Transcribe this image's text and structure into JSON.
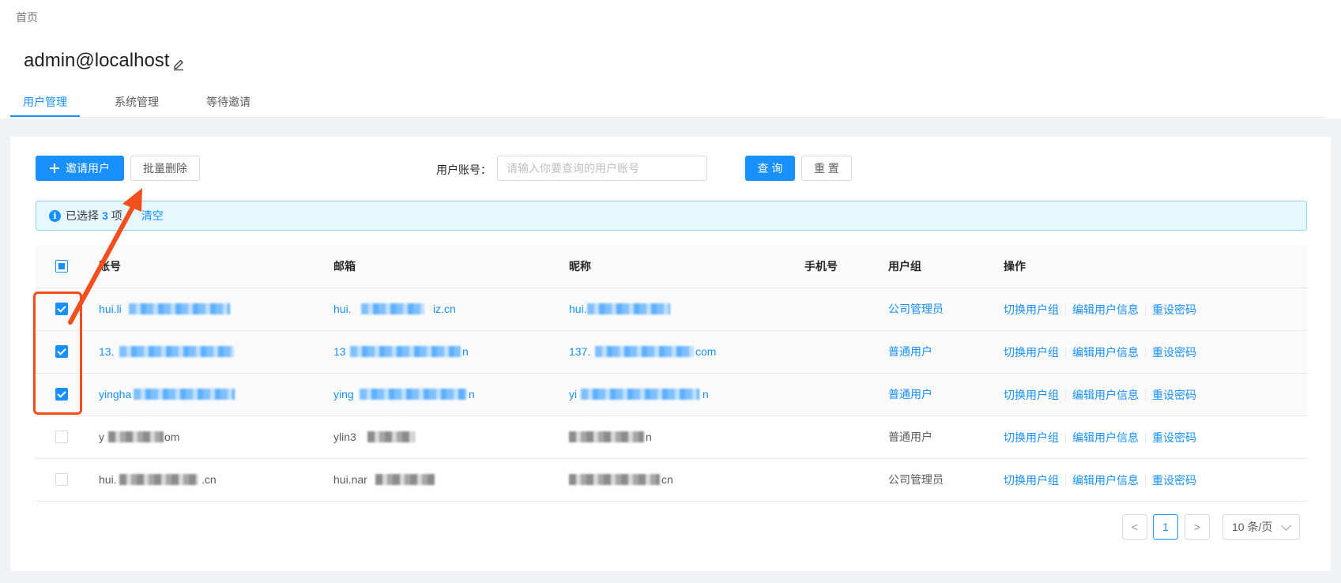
{
  "breadcrumb": "首页",
  "page_title": "admin@localhost",
  "tabs": [
    {
      "label": "用户管理",
      "active": true
    },
    {
      "label": "系统管理",
      "active": false
    },
    {
      "label": "等待邀请",
      "active": false
    }
  ],
  "toolbar": {
    "invite_label": "邀请用户",
    "batch_delete_label": "批量删除",
    "account_label": "用户账号：",
    "account_placeholder": "请输入你要查询的用户账号",
    "query_label": "查 询",
    "reset_label": "重 置"
  },
  "selection": {
    "prefix": "已选择",
    "count": "3",
    "suffix": "项",
    "clear_label": "清空"
  },
  "table": {
    "columns": [
      "账号",
      "邮箱",
      "昵称",
      "手机号",
      "用户组",
      "操作"
    ],
    "rows": [
      {
        "account": "hui.li",
        "email_start": "hui.",
        "email_end": "iz.cn",
        "nickname": "hui.",
        "phone": "",
        "group": "公司管理员",
        "checked": true
      },
      {
        "account": "13.",
        "email_start": "13",
        "email_end": "n",
        "nickname": "137.",
        "nickname_end": "com",
        "phone": "",
        "group": "普通用户",
        "checked": true
      },
      {
        "account": "yingha",
        "email_start": "ying",
        "email_end": "n",
        "nickname": "yi",
        "nickname_end": "n",
        "phone": "",
        "group": "普通用户",
        "checked": true
      },
      {
        "account": "y",
        "account_end": "om",
        "email_start": "ylin3",
        "email_end": "",
        "nickname": "",
        "nickname_end": "n",
        "phone": "",
        "group": "普通用户",
        "checked": false
      },
      {
        "account": "hui.",
        "account_end": ".cn",
        "email_start": "hui.nar",
        "email_end": "",
        "nickname": "",
        "nickname_end": "cn",
        "phone": "",
        "group": "公司管理员",
        "checked": false
      }
    ],
    "actions": [
      "切换用户组",
      "编辑用户信息",
      "重设密码"
    ]
  },
  "pagination": {
    "prev": "<",
    "current_page": "1",
    "next": ">",
    "page_size": "10 条/页"
  },
  "colors": {
    "primary": "#1890ff",
    "annotation": "#f24e1e"
  }
}
